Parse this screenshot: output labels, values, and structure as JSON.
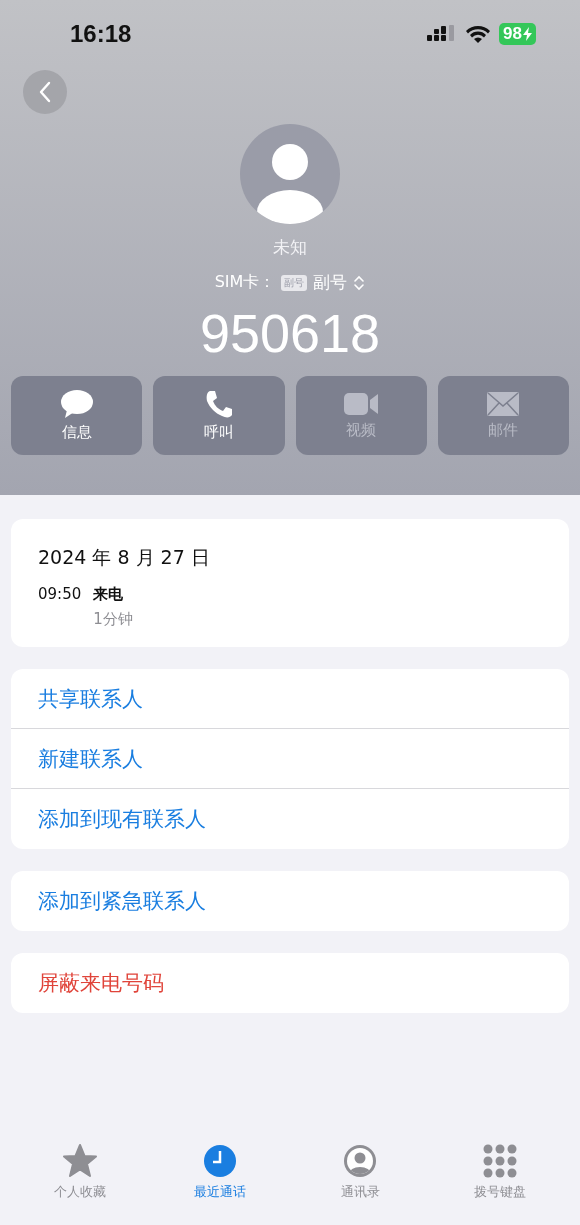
{
  "status_bar": {
    "time": "16:18",
    "battery": "98"
  },
  "contact": {
    "name": "未知",
    "sim_label": "SIM卡：",
    "sim_badge": "副号",
    "sim_value": "副号",
    "number": "950618"
  },
  "actions": [
    {
      "kind": "message",
      "label": "信息",
      "disabled": false
    },
    {
      "kind": "call",
      "label": "呼叫",
      "disabled": false
    },
    {
      "kind": "video",
      "label": "视频",
      "disabled": true
    },
    {
      "kind": "mail",
      "label": "邮件",
      "disabled": true
    }
  ],
  "call_log": {
    "date": "2024 年 8 月 27 日",
    "entries": [
      {
        "time": "09:50",
        "type": "来电",
        "duration": "1分钟"
      }
    ]
  },
  "menu_groups": [
    [
      {
        "label": "共享联系人",
        "destructive": false
      },
      {
        "label": "新建联系人",
        "destructive": false
      },
      {
        "label": "添加到现有联系人",
        "destructive": false
      }
    ],
    [
      {
        "label": "添加到紧急联系人",
        "destructive": false
      }
    ],
    [
      {
        "label": "屏蔽来电号码",
        "destructive": true
      }
    ]
  ],
  "tab_bar": [
    {
      "kind": "favorites",
      "label": "个人收藏",
      "selected": false
    },
    {
      "kind": "recents",
      "label": "最近通话",
      "selected": true
    },
    {
      "kind": "contacts",
      "label": "通讯录",
      "selected": false
    },
    {
      "kind": "keypad",
      "label": "拨号键盘",
      "selected": false
    }
  ]
}
